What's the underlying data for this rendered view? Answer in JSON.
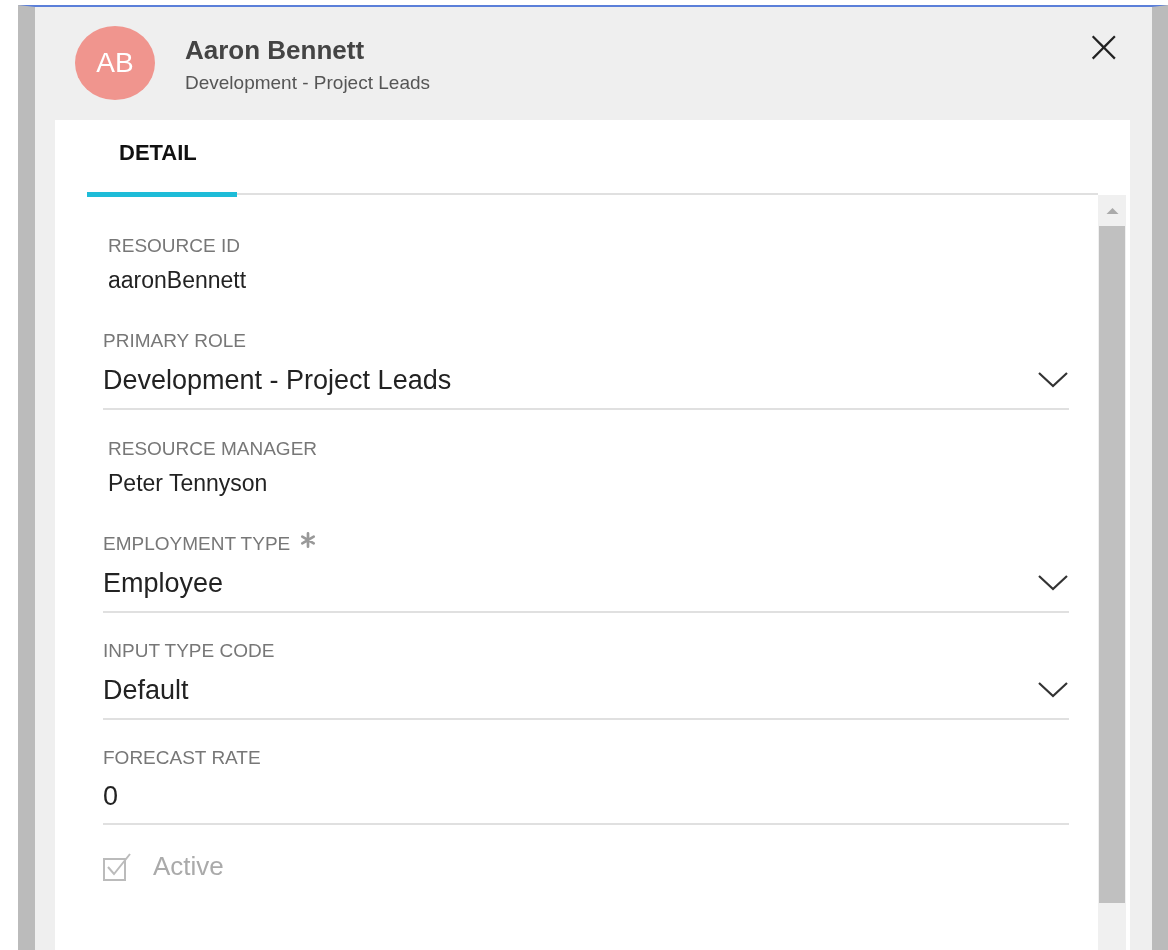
{
  "header": {
    "avatar_initials": "AB",
    "name": "Aaron Bennett",
    "subtitle": "Development - Project Leads",
    "close": "×"
  },
  "tabs": [
    {
      "label": "DETAIL",
      "selected": true
    }
  ],
  "fields": [
    {
      "kind": "text",
      "label": "RESOURCE ID",
      "value": "aaronBennett"
    },
    {
      "kind": "select",
      "label": "PRIMARY ROLE",
      "value": "Development - Project Leads",
      "required": false
    },
    {
      "kind": "text",
      "label": "RESOURCE MANAGER",
      "value": "Peter Tennyson"
    },
    {
      "kind": "select",
      "label": "EMPLOYMENT TYPE",
      "value": "Employee",
      "required": true
    },
    {
      "kind": "select",
      "label": "INPUT TYPE CODE",
      "value": "Default",
      "required": false
    },
    {
      "kind": "input",
      "label": "FORECAST RATE",
      "value": "0"
    }
  ],
  "checkbox": {
    "label": "Active",
    "checked": true,
    "disabled": true
  }
}
